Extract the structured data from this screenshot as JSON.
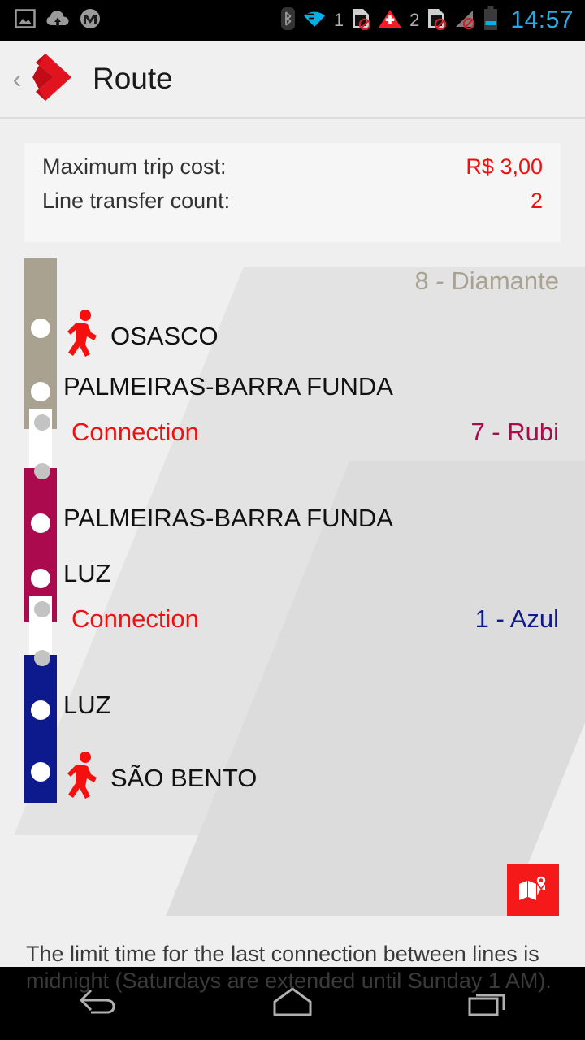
{
  "statusbar": {
    "left_icons": [
      "gallery-icon",
      "cloud-upload-icon",
      "motorola-icon"
    ],
    "right_icons": [
      "bluetooth-icon",
      "wifi-icon",
      "sim1-disabled-icon",
      "alert-triangle-icon",
      "sim2-disabled-icon",
      "signal-disabled-icon",
      "battery-icon"
    ],
    "sim1_number": "1",
    "sim2_number": "2",
    "clock": "14:57",
    "clock_color": "#2ea8e0"
  },
  "actionbar": {
    "back_label": "‹",
    "logo_name": "cptm-diamond-logo",
    "title": "Route"
  },
  "summary": {
    "cost_label": "Maximum trip cost:",
    "cost_value": "R$ 3,00",
    "transfer_label": "Line transfer count:",
    "transfer_value": "2",
    "value_color": "#ee1111"
  },
  "route": {
    "connection_label": "Connection",
    "segments": [
      {
        "line_label": "8 - Diamante",
        "line_color": "#a9a291",
        "stations": [
          {
            "name": "OSASCO",
            "walk": true
          },
          {
            "name": "PALMEIRAS-BARRA FUNDA",
            "walk": false
          }
        ]
      },
      {
        "line_label": "7 - Rubi",
        "line_color": "#ab0b4e",
        "stations": [
          {
            "name": "PALMEIRAS-BARRA FUNDA",
            "walk": false
          },
          {
            "name": "LUZ",
            "walk": false
          }
        ]
      },
      {
        "line_label": "1 - Azul",
        "line_color": "#0d1a8e",
        "stations": [
          {
            "name": "LUZ",
            "walk": false
          },
          {
            "name": "SÃO BENTO",
            "walk": true
          }
        ]
      }
    ]
  },
  "map_button": {
    "icon": "map-pin-icon",
    "color": "#f51919"
  },
  "footnote": "The limit time for the last connection between lines is midnight (Saturdays are extended until Sunday 1 AM).",
  "navbar": {
    "buttons": [
      "back-icon",
      "home-icon",
      "recents-icon"
    ]
  }
}
